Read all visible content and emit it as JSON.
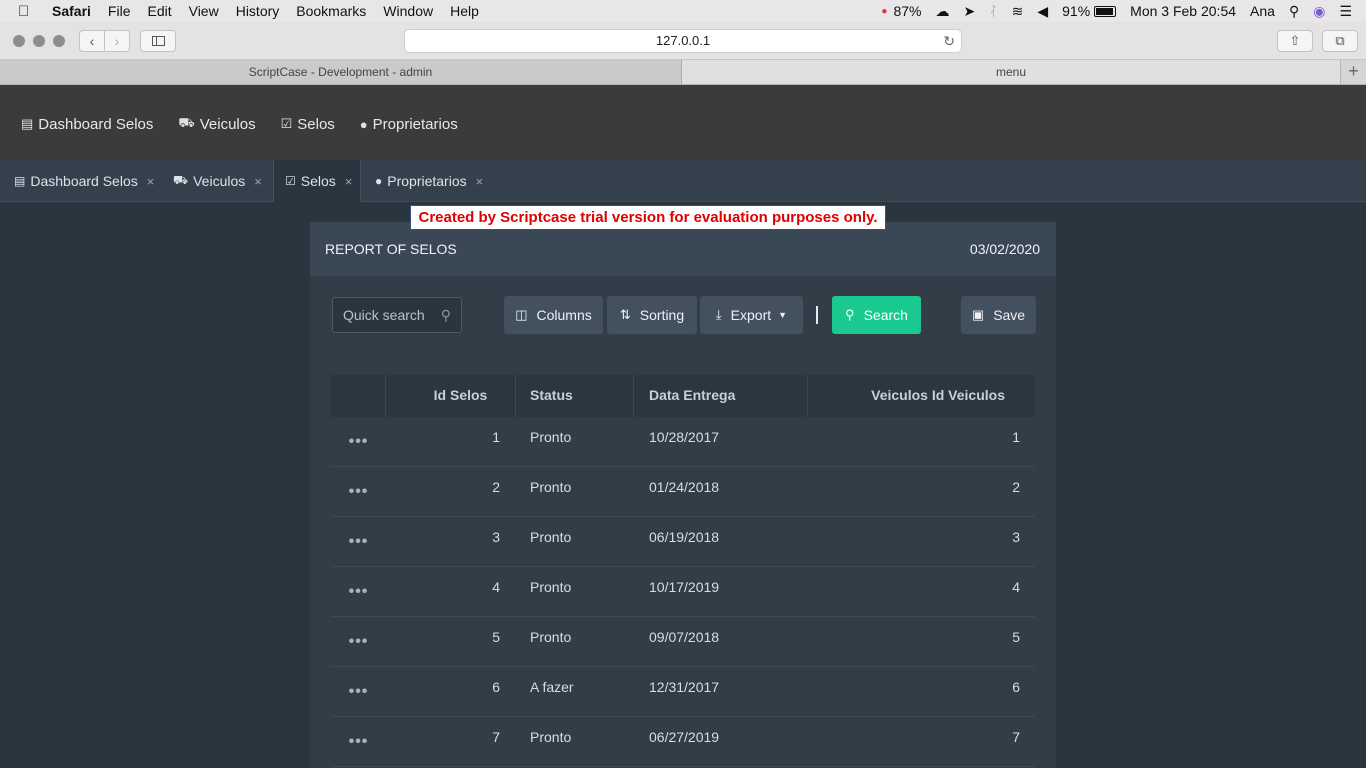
{
  "menubar": {
    "app": "Safari",
    "items": [
      "File",
      "Edit",
      "View",
      "History",
      "Bookmarks",
      "Window",
      "Help"
    ],
    "status": {
      "cpu": "87%",
      "battery": "91%",
      "datetime": "Mon 3 Feb  20:54",
      "user": "Ana"
    }
  },
  "browser": {
    "url": "127.0.0.1",
    "tabs": [
      "ScriptCase - Development - admin",
      "menu"
    ],
    "new_tab": "+"
  },
  "app_nav": {
    "items": [
      "Dashboard Selos",
      "Veiculos",
      "Selos",
      "Proprietarios"
    ]
  },
  "app_tabs": {
    "items": [
      "Dashboard Selos",
      "Veiculos",
      "Selos",
      "Proprietarios"
    ],
    "active": "Selos",
    "close": "×"
  },
  "watermark": "Created by Scriptcase trial version for evaluation purposes only.",
  "report": {
    "title": "REPORT OF SELOS",
    "date": "03/02/2020",
    "quick_search_placeholder": "Quick search",
    "buttons": {
      "columns": "Columns",
      "sorting": "Sorting",
      "export": "Export",
      "search": "Search",
      "save": "Save"
    },
    "separator": "|",
    "columns": [
      "Id Selos",
      "Status",
      "Data Entrega",
      "Veiculos Id Veiculos"
    ],
    "row_menu": "•••",
    "rows": [
      {
        "id": "1",
        "status": "Pronto",
        "data": "10/28/2017",
        "veiculo": "1"
      },
      {
        "id": "2",
        "status": "Pronto",
        "data": "01/24/2018",
        "veiculo": "2"
      },
      {
        "id": "3",
        "status": "Pronto",
        "data": "06/19/2018",
        "veiculo": "3"
      },
      {
        "id": "4",
        "status": "Pronto",
        "data": "10/17/2019",
        "veiculo": "4"
      },
      {
        "id": "5",
        "status": "Pronto",
        "data": "09/07/2018",
        "veiculo": "5"
      },
      {
        "id": "6",
        "status": "A fazer",
        "data": "12/31/2017",
        "veiculo": "6"
      },
      {
        "id": "7",
        "status": "Pronto",
        "data": "06/27/2019",
        "veiculo": "7"
      }
    ]
  },
  "colors": {
    "search_button": "#19c98f",
    "watermark_text": "#e00000",
    "app_header": "#3b3b3b",
    "page_bg": "#2b3540"
  }
}
